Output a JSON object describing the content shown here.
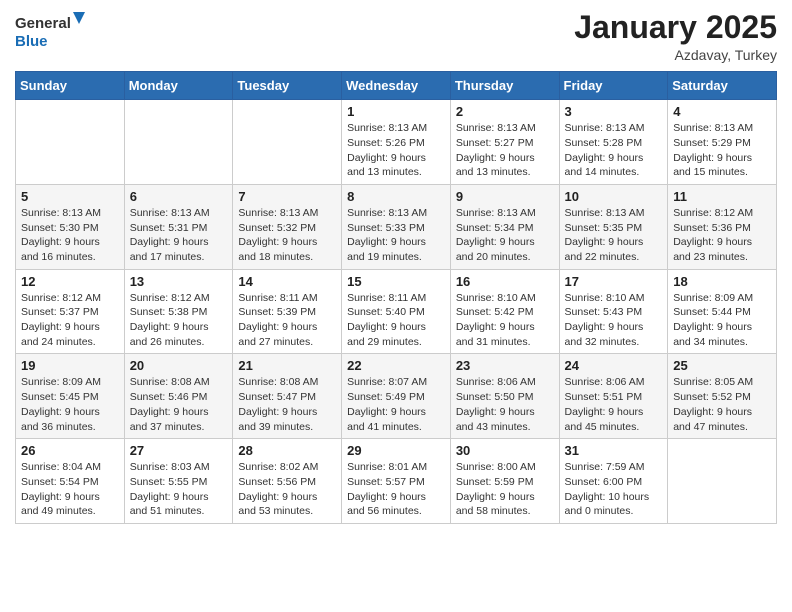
{
  "logo": {
    "general": "General",
    "blue": "Blue"
  },
  "title": "January 2025",
  "location": "Azdavay, Turkey",
  "days_of_week": [
    "Sunday",
    "Monday",
    "Tuesday",
    "Wednesday",
    "Thursday",
    "Friday",
    "Saturday"
  ],
  "weeks": [
    [
      {
        "day": "",
        "info": ""
      },
      {
        "day": "",
        "info": ""
      },
      {
        "day": "",
        "info": ""
      },
      {
        "day": "1",
        "info": "Sunrise: 8:13 AM\nSunset: 5:26 PM\nDaylight: 9 hours\nand 13 minutes."
      },
      {
        "day": "2",
        "info": "Sunrise: 8:13 AM\nSunset: 5:27 PM\nDaylight: 9 hours\nand 13 minutes."
      },
      {
        "day": "3",
        "info": "Sunrise: 8:13 AM\nSunset: 5:28 PM\nDaylight: 9 hours\nand 14 minutes."
      },
      {
        "day": "4",
        "info": "Sunrise: 8:13 AM\nSunset: 5:29 PM\nDaylight: 9 hours\nand 15 minutes."
      }
    ],
    [
      {
        "day": "5",
        "info": "Sunrise: 8:13 AM\nSunset: 5:30 PM\nDaylight: 9 hours\nand 16 minutes."
      },
      {
        "day": "6",
        "info": "Sunrise: 8:13 AM\nSunset: 5:31 PM\nDaylight: 9 hours\nand 17 minutes."
      },
      {
        "day": "7",
        "info": "Sunrise: 8:13 AM\nSunset: 5:32 PM\nDaylight: 9 hours\nand 18 minutes."
      },
      {
        "day": "8",
        "info": "Sunrise: 8:13 AM\nSunset: 5:33 PM\nDaylight: 9 hours\nand 19 minutes."
      },
      {
        "day": "9",
        "info": "Sunrise: 8:13 AM\nSunset: 5:34 PM\nDaylight: 9 hours\nand 20 minutes."
      },
      {
        "day": "10",
        "info": "Sunrise: 8:13 AM\nSunset: 5:35 PM\nDaylight: 9 hours\nand 22 minutes."
      },
      {
        "day": "11",
        "info": "Sunrise: 8:12 AM\nSunset: 5:36 PM\nDaylight: 9 hours\nand 23 minutes."
      }
    ],
    [
      {
        "day": "12",
        "info": "Sunrise: 8:12 AM\nSunset: 5:37 PM\nDaylight: 9 hours\nand 24 minutes."
      },
      {
        "day": "13",
        "info": "Sunrise: 8:12 AM\nSunset: 5:38 PM\nDaylight: 9 hours\nand 26 minutes."
      },
      {
        "day": "14",
        "info": "Sunrise: 8:11 AM\nSunset: 5:39 PM\nDaylight: 9 hours\nand 27 minutes."
      },
      {
        "day": "15",
        "info": "Sunrise: 8:11 AM\nSunset: 5:40 PM\nDaylight: 9 hours\nand 29 minutes."
      },
      {
        "day": "16",
        "info": "Sunrise: 8:10 AM\nSunset: 5:42 PM\nDaylight: 9 hours\nand 31 minutes."
      },
      {
        "day": "17",
        "info": "Sunrise: 8:10 AM\nSunset: 5:43 PM\nDaylight: 9 hours\nand 32 minutes."
      },
      {
        "day": "18",
        "info": "Sunrise: 8:09 AM\nSunset: 5:44 PM\nDaylight: 9 hours\nand 34 minutes."
      }
    ],
    [
      {
        "day": "19",
        "info": "Sunrise: 8:09 AM\nSunset: 5:45 PM\nDaylight: 9 hours\nand 36 minutes."
      },
      {
        "day": "20",
        "info": "Sunrise: 8:08 AM\nSunset: 5:46 PM\nDaylight: 9 hours\nand 37 minutes."
      },
      {
        "day": "21",
        "info": "Sunrise: 8:08 AM\nSunset: 5:47 PM\nDaylight: 9 hours\nand 39 minutes."
      },
      {
        "day": "22",
        "info": "Sunrise: 8:07 AM\nSunset: 5:49 PM\nDaylight: 9 hours\nand 41 minutes."
      },
      {
        "day": "23",
        "info": "Sunrise: 8:06 AM\nSunset: 5:50 PM\nDaylight: 9 hours\nand 43 minutes."
      },
      {
        "day": "24",
        "info": "Sunrise: 8:06 AM\nSunset: 5:51 PM\nDaylight: 9 hours\nand 45 minutes."
      },
      {
        "day": "25",
        "info": "Sunrise: 8:05 AM\nSunset: 5:52 PM\nDaylight: 9 hours\nand 47 minutes."
      }
    ],
    [
      {
        "day": "26",
        "info": "Sunrise: 8:04 AM\nSunset: 5:54 PM\nDaylight: 9 hours\nand 49 minutes."
      },
      {
        "day": "27",
        "info": "Sunrise: 8:03 AM\nSunset: 5:55 PM\nDaylight: 9 hours\nand 51 minutes."
      },
      {
        "day": "28",
        "info": "Sunrise: 8:02 AM\nSunset: 5:56 PM\nDaylight: 9 hours\nand 53 minutes."
      },
      {
        "day": "29",
        "info": "Sunrise: 8:01 AM\nSunset: 5:57 PM\nDaylight: 9 hours\nand 56 minutes."
      },
      {
        "day": "30",
        "info": "Sunrise: 8:00 AM\nSunset: 5:59 PM\nDaylight: 9 hours\nand 58 minutes."
      },
      {
        "day": "31",
        "info": "Sunrise: 7:59 AM\nSunset: 6:00 PM\nDaylight: 10 hours\nand 0 minutes."
      },
      {
        "day": "",
        "info": ""
      }
    ]
  ]
}
